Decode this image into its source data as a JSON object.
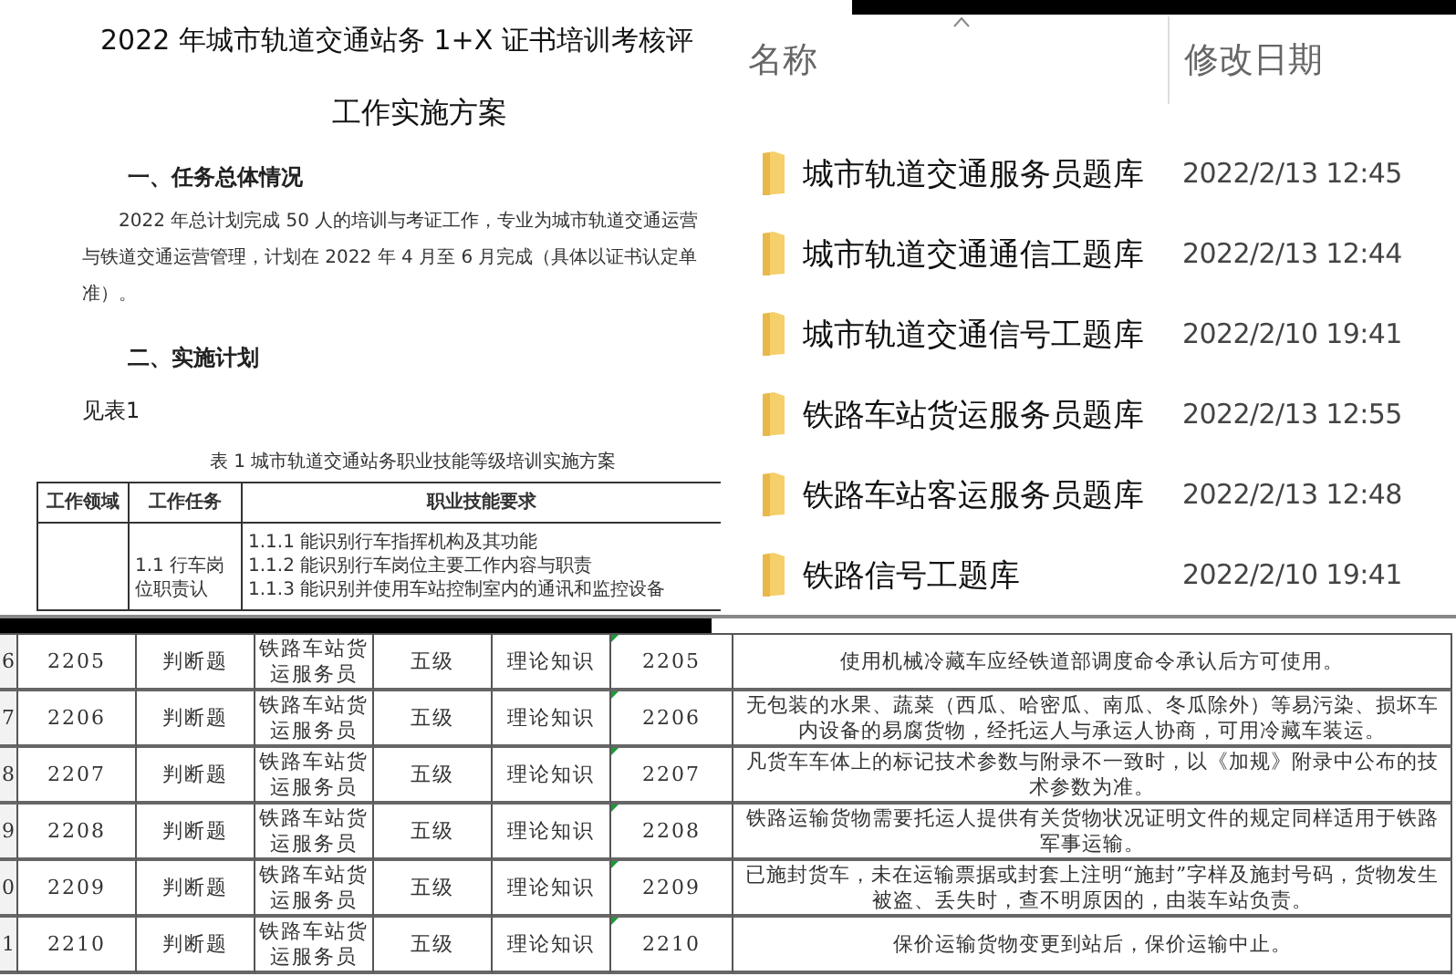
{
  "document": {
    "title": "2022 年城市轨道交通站务 1+X 证书培训考核评",
    "subtitle": "工作实施方案",
    "section_1_heading": "一、任务总体情况",
    "paragraph_lines": [
      "2022 年总计划完成 50 人的培训与考证工作，专业为城市轨道交通运营",
      "与铁道交通运营管理，计划在 2022 年 4 月至 6 月完成（具体以证书认定单",
      "准）。"
    ],
    "section_2_heading": "二、实施计划",
    "table_reference": "见表1",
    "table_caption": "表 1 城市轨道交通站务职业技能等级培训实施方案",
    "table": {
      "columns": [
        "工作领域",
        "工作任务",
        "职业技能要求"
      ],
      "rows": [
        {
          "area": "",
          "task": "1.1 行车岗位职责认",
          "skills": [
            "1.1.1 能识别行车指挥机构及其功能",
            "1.1.2 能识别行车岗位主要工作内容与职责",
            "1.1.3 能识别并使用车站控制室内的通讯和监控设备"
          ]
        }
      ]
    }
  },
  "explorer": {
    "columns": [
      {
        "label": "名称",
        "sorted": true
      },
      {
        "label": "修改日期",
        "sorted": false
      }
    ],
    "items": [
      {
        "name": "城市轨道交通服务员题库",
        "modified": "2022/2/13 12:45"
      },
      {
        "name": "城市轨道交通通信工题库",
        "modified": "2022/2/13 12:44"
      },
      {
        "name": "城市轨道交通信号工题库",
        "modified": "2022/2/10 19:41"
      },
      {
        "name": "铁路车站货运服务员题库",
        "modified": "2022/2/13 12:55"
      },
      {
        "name": "铁路车站客运服务员题库",
        "modified": "2022/2/13 12:48"
      },
      {
        "name": "铁路信号工题库",
        "modified": "2022/2/10 19:41"
      }
    ]
  },
  "sheet": {
    "rows": [
      {
        "row_number": "6",
        "cells": [
          "2205",
          "判断题",
          "铁路车站货运服务员",
          "五级",
          "理论知识",
          "2205"
        ],
        "description": "使用机械冷藏车应经铁道部调度命令承认后方可使用。"
      },
      {
        "row_number": "7",
        "cells": [
          "2206",
          "判断题",
          "铁路车站货运服务员",
          "五级",
          "理论知识",
          "2206"
        ],
        "description": "无包装的水果、蔬菜（西瓜、哈密瓜、南瓜、冬瓜除外）等易污染、损坏车内设备的易腐货物，经托运人与承运人协商，可用冷藏车装运。"
      },
      {
        "row_number": "8",
        "cells": [
          "2207",
          "判断题",
          "铁路车站货运服务员",
          "五级",
          "理论知识",
          "2207"
        ],
        "description": "凡货车车体上的标记技术参数与附录不一致时，以《加规》附录中公布的技术参数为准。"
      },
      {
        "row_number": "9",
        "cells": [
          "2208",
          "判断题",
          "铁路车站货运服务员",
          "五级",
          "理论知识",
          "2208"
        ],
        "description": "铁路运输货物需要托运人提供有关货物状况证明文件的规定同样适用于铁路军事运输。"
      },
      {
        "row_number": "0",
        "cells": [
          "2209",
          "判断题",
          "铁路车站货运服务员",
          "五级",
          "理论知识",
          "2209"
        ],
        "description": "已施封货车，未在运输票据或封套上注明“施封”字样及施封号码，货物发生被盗、丢失时，查不明原因的，由装车站负责。"
      },
      {
        "row_number": "1",
        "cells": [
          "2210",
          "判断题",
          "铁路车站货运服务员",
          "五级",
          "理论知识",
          "2210"
        ],
        "description": "保价运输货物变更到站后，保价运输中止。"
      }
    ]
  }
}
